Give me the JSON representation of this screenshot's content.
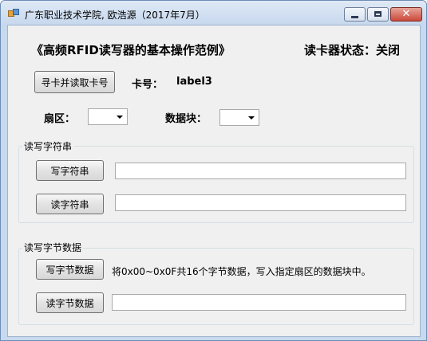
{
  "window": {
    "title": "广东职业技术学院, 欧浩源（2017年7月）",
    "close_glyph": "✕"
  },
  "header": {
    "heading": "《高频RFID读写器的基本操作范例》",
    "reader_status": "读卡器状态：关闭"
  },
  "card": {
    "find_read_button": "寻卡并读取卡号",
    "card_label": "卡号：",
    "card_value": "label3"
  },
  "selectors": {
    "sector_label": "扇区：",
    "block_label": "数据块："
  },
  "string_group": {
    "legend": "读写字符串",
    "write_button": "写字符串",
    "read_button": "读字符串"
  },
  "byte_group": {
    "legend": "读写字节数据",
    "write_button": "写字节数据",
    "write_description": "将0x00~0x0F共16个字节数据，写入指定扇区的数据块中。",
    "read_button": "读字节数据"
  }
}
